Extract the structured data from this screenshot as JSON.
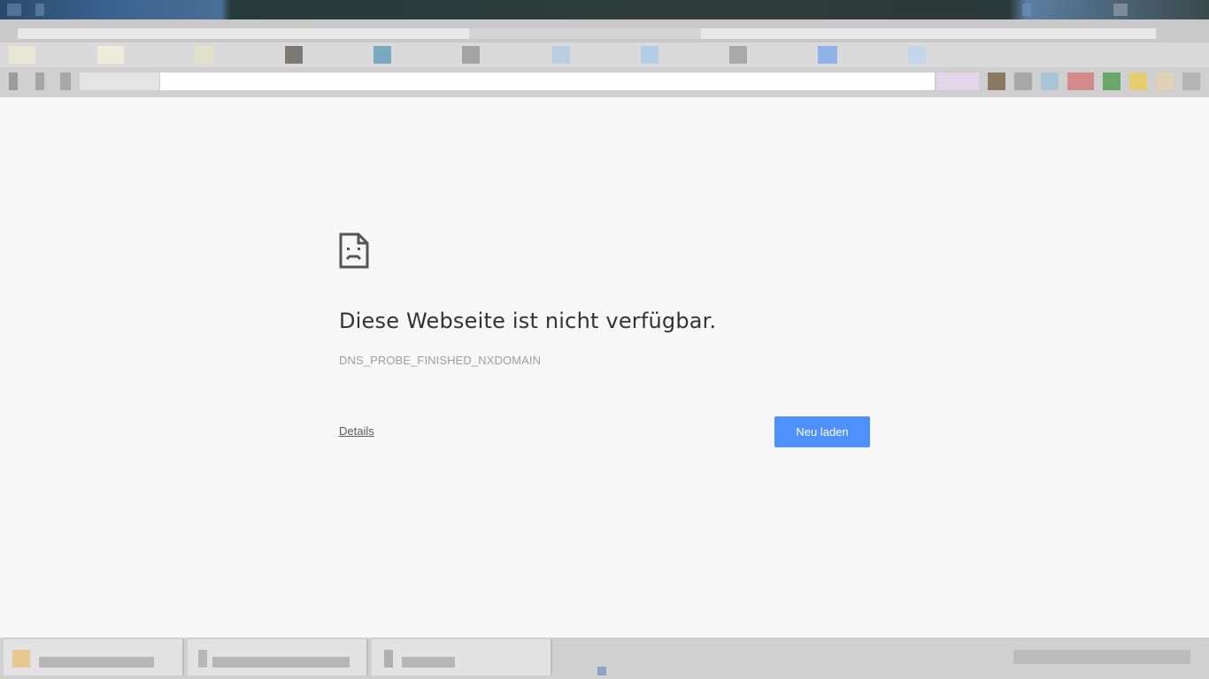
{
  "error_page": {
    "title": "Diese Webseite ist nicht verfügbar.",
    "error_code": "DNS_PROBE_FINISHED_NXDOMAIN",
    "details_link": "Details",
    "reload_button": "Neu laden",
    "icon": "sad-document-icon"
  },
  "colors": {
    "page_background": "#f7f7f7",
    "title_text": "#333333",
    "error_code_text": "#9e9e9e",
    "reload_button_bg": "#4d90fe"
  }
}
